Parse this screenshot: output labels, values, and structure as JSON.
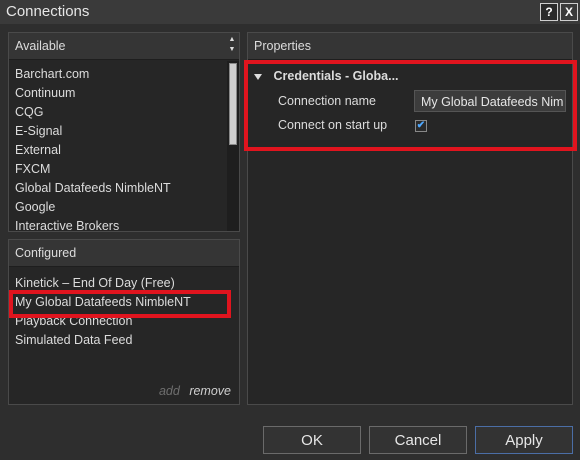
{
  "window": {
    "title": "Connections",
    "help_label": "?",
    "close_label": "X"
  },
  "available": {
    "title": "Available",
    "sort_up": "▲",
    "sort_down": "▼",
    "items": [
      "Barchart.com",
      "Continuum",
      "CQG",
      "E-Signal",
      "External",
      "FXCM",
      "Global Datafeeds NimbleNT",
      "Google",
      "Interactive Brokers"
    ]
  },
  "configured": {
    "title": "Configured",
    "items": [
      "Kinetick – End Of Day (Free)",
      "My Global Datafeeds NimbleNT",
      "Playback Connection",
      "Simulated Data Feed"
    ],
    "add_label": "add",
    "remove_label": "remove"
  },
  "properties": {
    "title": "Properties",
    "category": "Credentials - Globa...",
    "connection_name_label": "Connection name",
    "connection_name_value": "My Global Datafeeds Nim",
    "connect_on_startup_label": "Connect on start up",
    "connect_on_startup_checked": true,
    "check_mark": "✔"
  },
  "buttons": {
    "ok": "OK",
    "cancel": "Cancel",
    "apply": "Apply"
  },
  "colors": {
    "highlight": "#e0141e",
    "background": "#2e2e2e",
    "panel": "#262626"
  }
}
